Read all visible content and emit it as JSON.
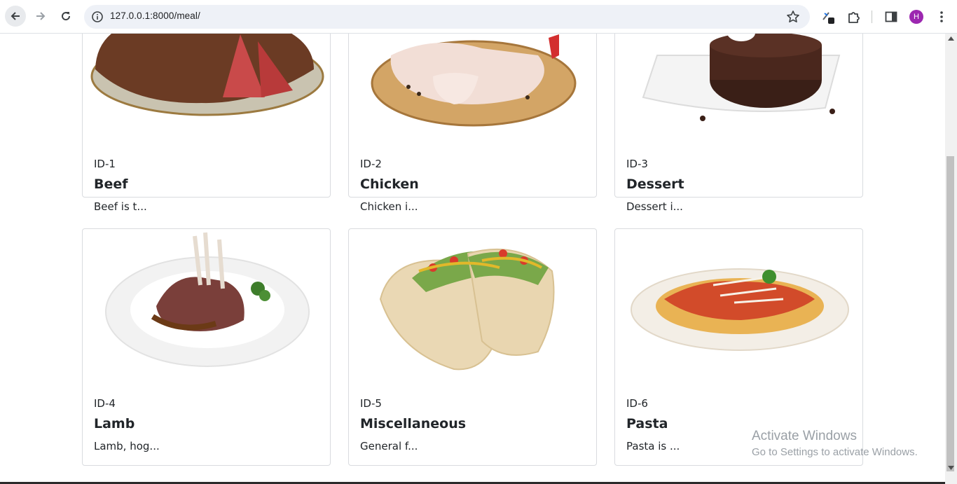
{
  "browser": {
    "url": "127.0.0.1:8000/meal/",
    "profile_initial": "H"
  },
  "icons": {
    "back": "arrow-left-icon",
    "forward": "arrow-right-icon",
    "reload": "reload-icon",
    "site_info": "info-icon",
    "bookmark": "star-icon",
    "extension": "puzzle-icon",
    "side_panel": "side-panel-icon",
    "menu": "kebab-menu-icon"
  },
  "meals": [
    {
      "id": "ID-1",
      "name": "Beef",
      "description": "Beef is t..."
    },
    {
      "id": "ID-2",
      "name": "Chicken",
      "description": "Chicken i..."
    },
    {
      "id": "ID-3",
      "name": "Dessert",
      "description": "Dessert i..."
    },
    {
      "id": "ID-4",
      "name": "Lamb",
      "description": "Lamb, hog..."
    },
    {
      "id": "ID-5",
      "name": "Miscellaneous",
      "description": "General f..."
    },
    {
      "id": "ID-6",
      "name": "Pasta",
      "description": "Pasta is ..."
    }
  ],
  "watermark": {
    "line1": "Activate Windows",
    "line2": "Go to Settings to activate Windows."
  },
  "colors": {
    "avatar": "#9c27b0",
    "card_border": "#d9dbdf",
    "text": "#212529"
  }
}
